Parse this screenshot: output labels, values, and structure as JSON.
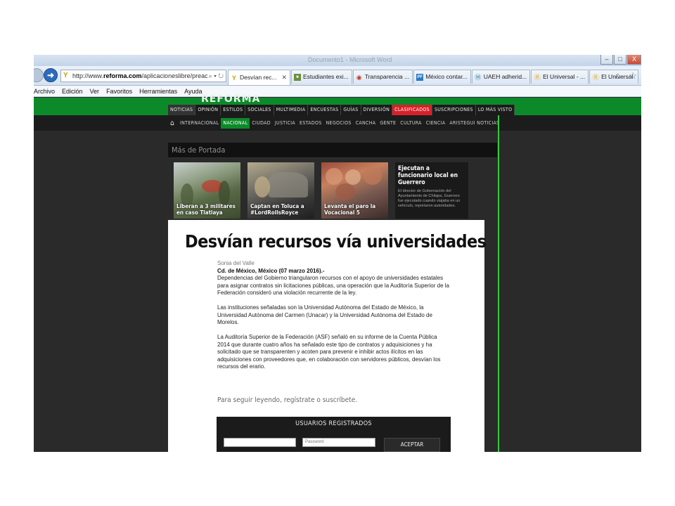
{
  "browser": {
    "title": "Documento1 - Microsoft Word",
    "window_buttons": [
      "–",
      "□",
      "X"
    ],
    "address": {
      "prefix": "http://www.",
      "domain": "reforma.com",
      "path": "/aplicacioneslibre/preacceso",
      "controls": "⌕ ▾ ↻"
    },
    "tabs": [
      {
        "label": "Desvían rec...",
        "icon": "reforma-icon",
        "active": true,
        "closable": true
      },
      {
        "label": "Estudiantes exi...",
        "icon": "news-icon"
      },
      {
        "label": "Transparencia ...",
        "icon": "transparencia-icon"
      },
      {
        "label": "México contar...",
        "icon": "pf-icon"
      },
      {
        "label": "UAEH adherid...",
        "icon": "wordpress-icon"
      },
      {
        "label": "El Universal - ...",
        "icon": "ie-icon"
      },
      {
        "label": "El Universal",
        "icon": "ie-icon"
      }
    ],
    "right_tools": "⌂ ☆",
    "menu": [
      "Archivo",
      "Edición",
      "Ver",
      "Favoritos",
      "Herramientas",
      "Ayuda"
    ]
  },
  "site": {
    "logo": "REFORMA",
    "nav_primary": [
      {
        "label": "NOTICIAS",
        "state": "on"
      },
      {
        "label": "OPINIÓN"
      },
      {
        "label": "ESTILOS"
      },
      {
        "label": "SOCIALES"
      },
      {
        "label": "MULTIMEDIA"
      },
      {
        "label": "ENCUESTAS"
      },
      {
        "label": "GUÍAS"
      },
      {
        "label": "DIVERSIÓN"
      },
      {
        "label": "CLASIFICADOS",
        "state": "red"
      },
      {
        "label": "SUSCRIPCIONES"
      },
      {
        "label": "LO MÁS VISTO"
      }
    ],
    "nav_secondary": [
      {
        "label": "INTERNACIONAL"
      },
      {
        "label": "NACIONAL",
        "state": "on"
      },
      {
        "label": "CIUDAD"
      },
      {
        "label": "JUSTICIA"
      },
      {
        "label": "ESTADOS"
      },
      {
        "label": "NEGOCIOS"
      },
      {
        "label": "CANCHA"
      },
      {
        "label": "GENTE"
      },
      {
        "label": "CULTURA"
      },
      {
        "label": "CIENCIA"
      },
      {
        "label": "ARISTEGUI NOTICIAS"
      }
    ],
    "mas_de_portada": "Más de Portada",
    "tiles": [
      {
        "caption": "Liberan a 3 militares en caso Tlatlaya"
      },
      {
        "caption": "Captan en Toluca a #LordRollsRoyce"
      },
      {
        "caption": "Levanta el paro la Vocacional 5"
      }
    ],
    "text_tile": {
      "headline": "Ejecutan a funcionario local en Guerrero",
      "summary": "El director de Gobernación del Ayuntamiento de Chilapa, Guerrero fue ejecutado cuando viajaba en un vehículo, reportaron autoridades."
    }
  },
  "article": {
    "headline": "Desvían recursos vía universidades",
    "author": "Sonia del Valle",
    "dateline": "Cd. de México, México (07 marzo 2016).-",
    "p1": "Dependencias del Gobierno triangularon recursos con el apoyo de universidades estatales para asignar contratos sin licitaciones públicas, una operación que la Auditoría Superior de la Federación consideró una violación recurrente de la ley.",
    "p2": "Las instituciones señaladas son la Universidad Autónoma del Estado de México, la Universidad Autónoma del Carmen (Unacar) y la Universidad Autónoma del Estado de Morelos.",
    "p3": "La Auditoría Superior de la Federación (ASF) señaló en su informe de la Cuenta Pública 2014 que durante cuatro años ha señalado este tipo de contratos y adquisiciones y ha solicitado que se transparenten y acoten para prevenir e inhibir actos ilícitos en las adquisiciones con proveedores que, en colaboración con servidores públicos, desvían los recursos del erario.",
    "continue_text": "Para seguir leyendo, regístrate o suscríbete.",
    "login": {
      "title": "USUARIOS REGISTRADOS",
      "password_placeholder": "Password",
      "submit": "ACEPTAR"
    }
  },
  "colors": {
    "brand_green": "#0c8a2a",
    "accent_red": "#d6212a"
  }
}
